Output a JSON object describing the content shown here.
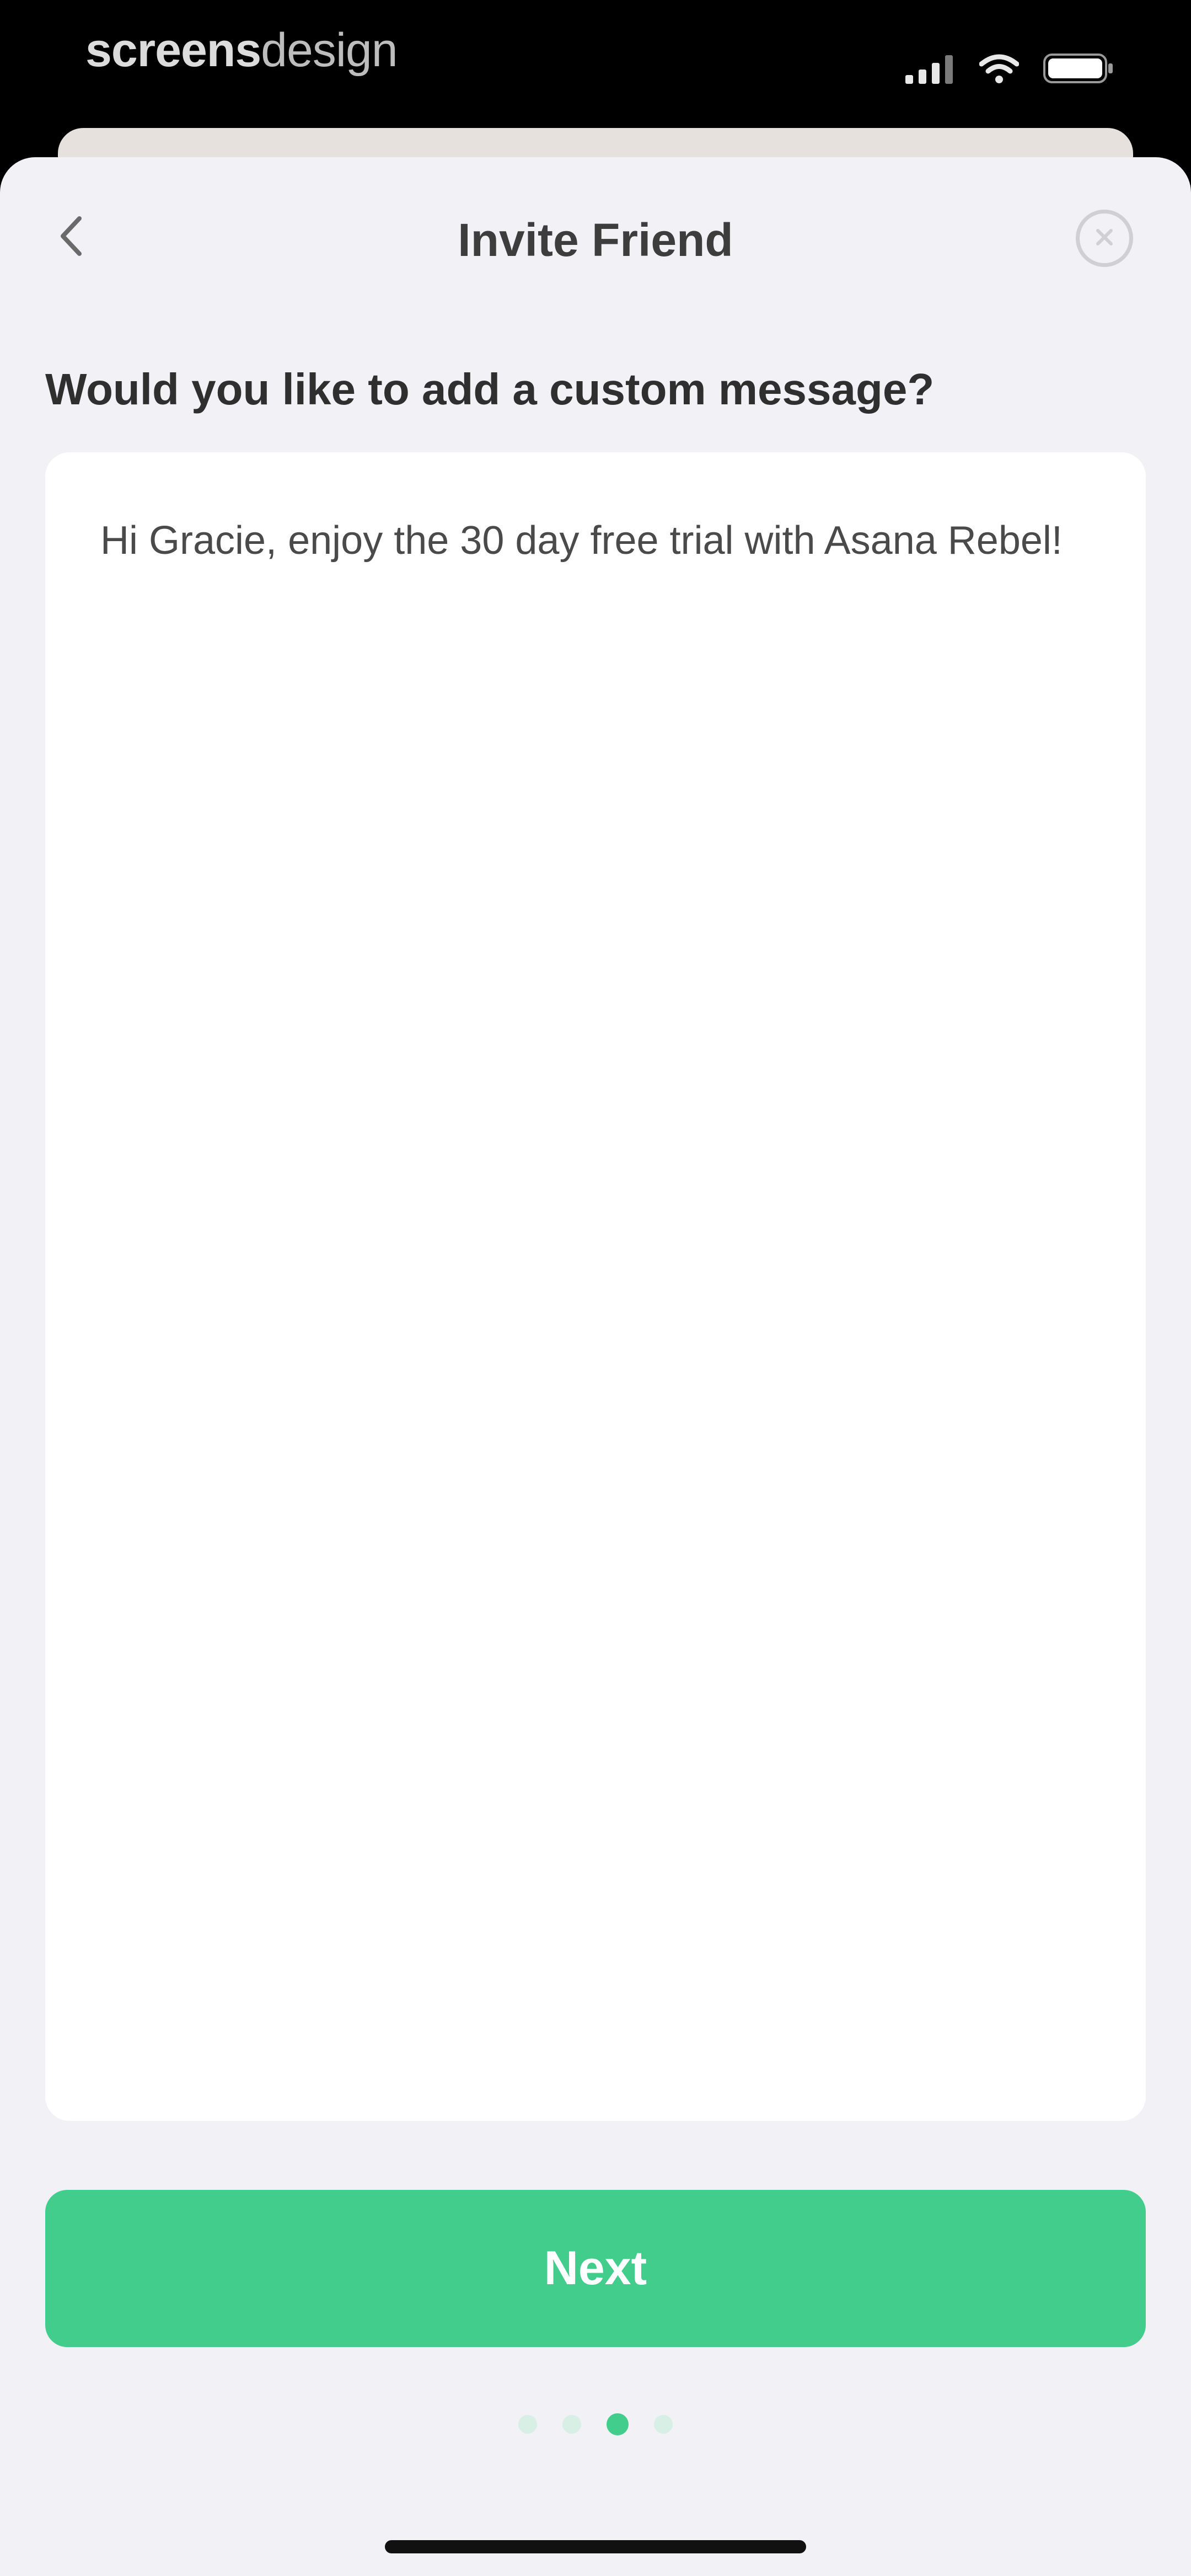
{
  "status_bar": {
    "brand_bold": "screens",
    "brand_light": "design",
    "icons": [
      "signal-icon",
      "wifi-icon",
      "battery-icon"
    ]
  },
  "nav": {
    "back_icon": "chevron-left-icon",
    "title": "Invite Friend",
    "close_icon": "close-circle-icon"
  },
  "main": {
    "question": "Would you like to add a custom message?",
    "message_value": "Hi Gracie, enjoy the 30 day free trial with Asana Rebel!",
    "next_label": "Next"
  },
  "pagination": {
    "total": 4,
    "current": 3
  },
  "colors": {
    "accent": "#43cd8d",
    "sheet_background": "#f1f1f6",
    "card_background": "#ffffff",
    "title_text": "#3d3d3d"
  }
}
